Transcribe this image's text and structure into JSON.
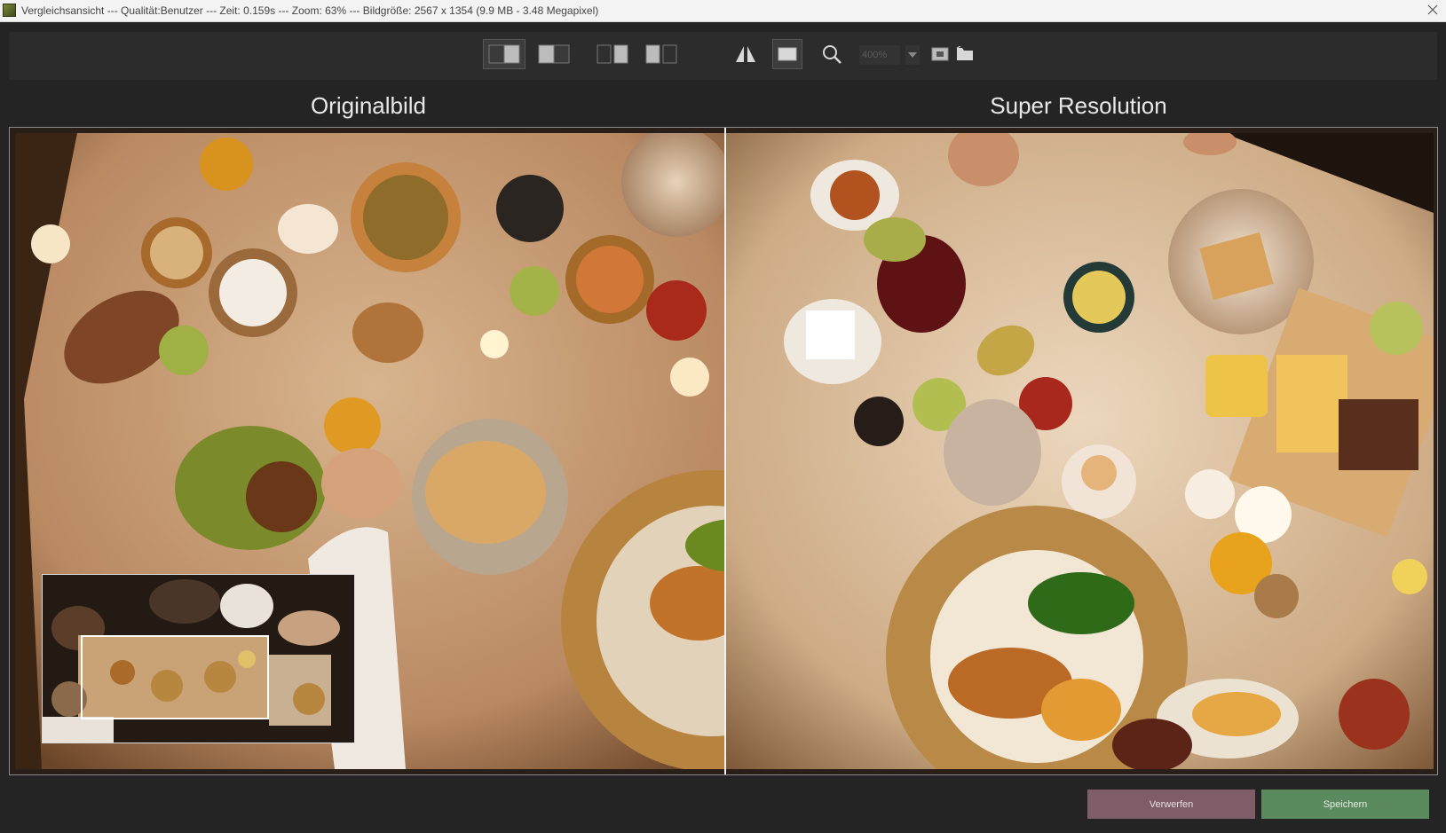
{
  "window": {
    "title": "Vergleichsansicht --- Qualität:Benutzer --- Zeit: 0.159s --- Zoom: 63% --- Bildgröße: 2567 x 1354 (9.9 MB - 3.48 Megapixel)"
  },
  "toolbar": {
    "view_modes": [
      {
        "icon": "split-vertical-icon",
        "active": true
      },
      {
        "icon": "split-left-icon",
        "active": false
      },
      {
        "icon": "side-by-side-dark-icon",
        "active": false
      },
      {
        "icon": "side-by-side-light-icon",
        "active": false
      }
    ],
    "tools": [
      {
        "icon": "mirror-icon",
        "active": false
      },
      {
        "icon": "fit-window-icon",
        "active": true
      },
      {
        "icon": "zoom-icon",
        "active": false
      }
    ],
    "zoom_value": "400%",
    "extra": [
      {
        "icon": "navigator-icon"
      },
      {
        "icon": "folder-icon"
      }
    ]
  },
  "panes": {
    "left_label": "Originalbild",
    "right_label": "Super Resolution"
  },
  "actions": {
    "discard_label": "Verwerfen",
    "save_label": "Speichern"
  },
  "colors": {
    "background": "#242424",
    "discard": "#7e5d68",
    "save": "#5a8a5e"
  }
}
